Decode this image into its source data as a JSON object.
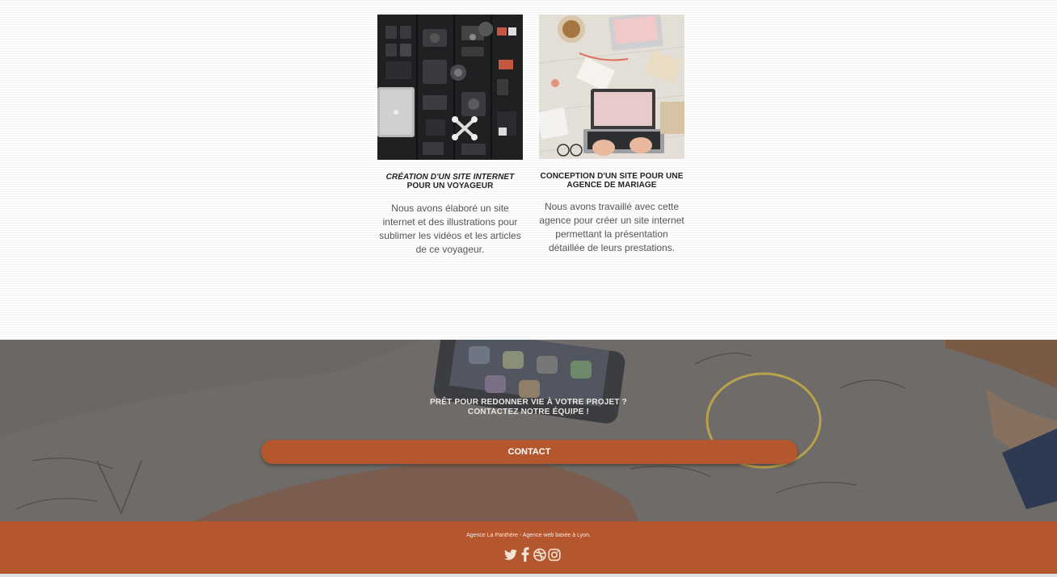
{
  "portfolio": {
    "items": [
      {
        "title_line1": "Création d'un site internet",
        "title_line2": "pour un voyageur",
        "description": "Nous avons élaboré un site internet et des illustrations pour sublimer les vidéos et les articles de ce voyageur."
      },
      {
        "title_line1": "Conception d'un site pour une",
        "title_line2": "agence de mariage",
        "description": "Nous avons travaillé avec cette agence pour créer un site internet permettant la présentation détaillée de leurs prestations."
      }
    ]
  },
  "cta": {
    "line1": "Prêt pour redonner vie à votre projet ?",
    "line2": "Contactez notre équipe !",
    "button_label": "CONTACT"
  },
  "footer": {
    "text": "Agence La Panthère - Agence web basée à Lyon.",
    "socials": [
      "twitter-icon",
      "facebook-icon",
      "dribbble-icon",
      "instagram-icon"
    ]
  },
  "colors": {
    "accent": "#b4572e",
    "text": "#555555"
  }
}
